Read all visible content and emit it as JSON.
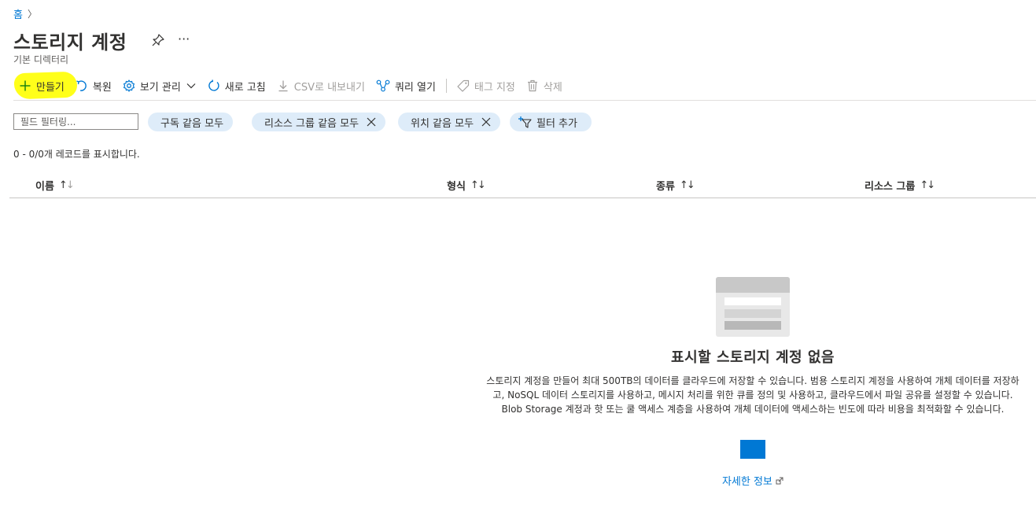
{
  "breadcrumb": {
    "home": "홈",
    "separator": "〉"
  },
  "page": {
    "title": "스토리지 계정",
    "more": "···",
    "subtitle": "기본 디렉터리"
  },
  "toolbar": {
    "create": "만들기",
    "restore": "복원",
    "manage_view": "보기 관리",
    "refresh": "새로 고침",
    "export_csv": "CSV로 내보내기",
    "open_query": "쿼리 열기",
    "assign_tags": "태그 지정",
    "delete": "삭제"
  },
  "filters": {
    "input_placeholder": "필드 필터링...",
    "pills": [
      {
        "label": "구독 같음 모두",
        "removable": false
      },
      {
        "label": "리소스 그룹 같음 모두",
        "removable": true
      },
      {
        "label": "위치 같음 모두",
        "removable": true
      }
    ],
    "add_filter": "필터 추가"
  },
  "record_count": "0 - 0/0개 레코드를 표시합니다.",
  "table": {
    "columns": [
      {
        "label": "이름"
      },
      {
        "label": "형식"
      },
      {
        "label": "종류"
      },
      {
        "label": "리소스 그룹"
      }
    ],
    "rows": []
  },
  "empty_state": {
    "title": "표시할 스토리지 계정 없음",
    "description": "스토리지 계정을 만들어 최대 500TB의 데이터를 클라우드에 저장할 수 있습니다. 범용 스토리지 계정을 사용하여 개체 데이터를 저장하고, NoSQL 데이터 스토리지를 사용하고, 메시지 처리를 위한 큐를 정의 및 사용하고, 클라우드에서 파일 공유를 설정할 수 있습니다. Blob Storage 계정과 핫 또는 쿨 액세스 계층을 사용하여 개체 데이터에 액세스하는 빈도에 따라 비용을 최적화할 수 있습니다.",
    "learn_more": "자세한 정보"
  },
  "colors": {
    "accent": "#0078d4",
    "pill_background": "#deecf9",
    "highlight": "#ffff1a",
    "disabled_text": "#a19f9d"
  },
  "icons": [
    "chevron-right-icon",
    "pin-icon",
    "plus-icon",
    "undo-icon",
    "gear-icon",
    "chevron-down-icon",
    "refresh-icon",
    "download-icon",
    "query-icon",
    "tag-icon",
    "trash-icon",
    "close-icon",
    "filter-add-icon",
    "sort-icon",
    "storage-illustration",
    "external-link-icon"
  ]
}
